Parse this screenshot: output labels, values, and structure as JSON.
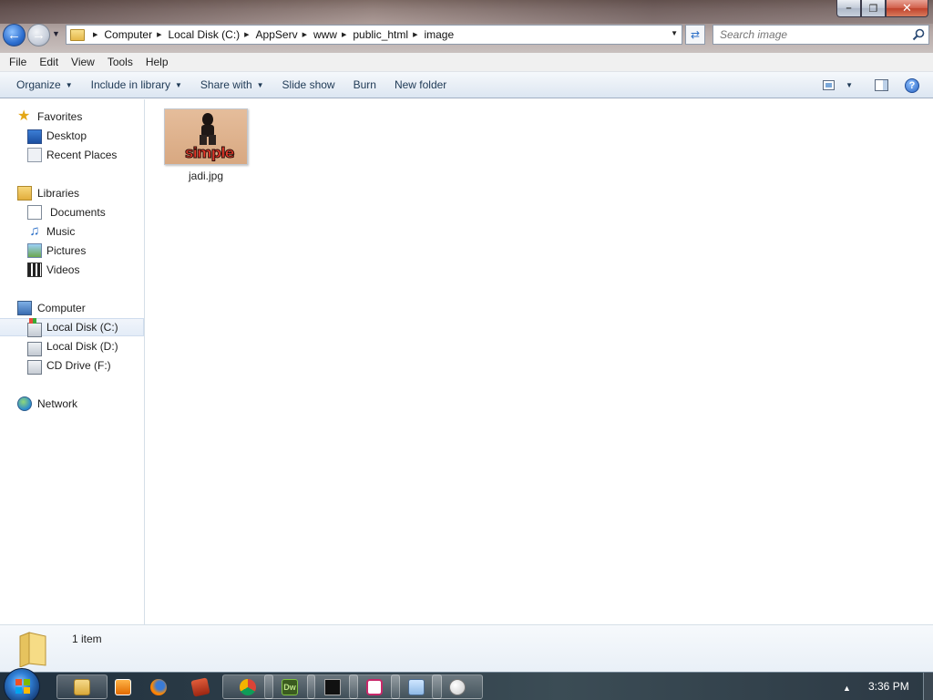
{
  "window": {
    "minimize_icon": "minimize-icon",
    "maximize_icon": "restore-icon",
    "close_icon": "close-icon"
  },
  "address_bar": {
    "crumbs": [
      "Computer",
      "Local Disk (C:)",
      "AppServ",
      "www",
      "public_html",
      "image"
    ]
  },
  "search": {
    "placeholder": "Search image"
  },
  "menu": [
    "File",
    "Edit",
    "View",
    "Tools",
    "Help"
  ],
  "commands": {
    "organize": "Organize",
    "include_in_library": "Include in library",
    "share_with": "Share with",
    "slide_show": "Slide show",
    "burn": "Burn",
    "new_folder": "New folder"
  },
  "nav": {
    "favorites": "Favorites",
    "desktop": "Desktop",
    "recent_places": "Recent Places",
    "libraries": "Libraries",
    "documents": "Documents",
    "music": "Music",
    "pictures": "Pictures",
    "videos": "Videos",
    "computer": "Computer",
    "local_disk_c": "Local Disk (C:)",
    "local_disk_d": "Local Disk (D:)",
    "cd_drive_f": "CD Drive (F:)",
    "network": "Network"
  },
  "files": [
    {
      "name": "jadi.jpg",
      "thumb_text": "simple"
    }
  ],
  "status": {
    "item_count": "1 item"
  },
  "taskbar": {
    "clock": "3:36 PM",
    "apps": [
      "windows-explorer",
      "media-player",
      "firefox",
      "presentation-app",
      "chrome",
      "dreamweaver",
      "command-prompt",
      "app-c",
      "notepad",
      "paint"
    ]
  },
  "colors": {
    "accent": "#2c6fc7",
    "command_text": "#1e3955"
  }
}
